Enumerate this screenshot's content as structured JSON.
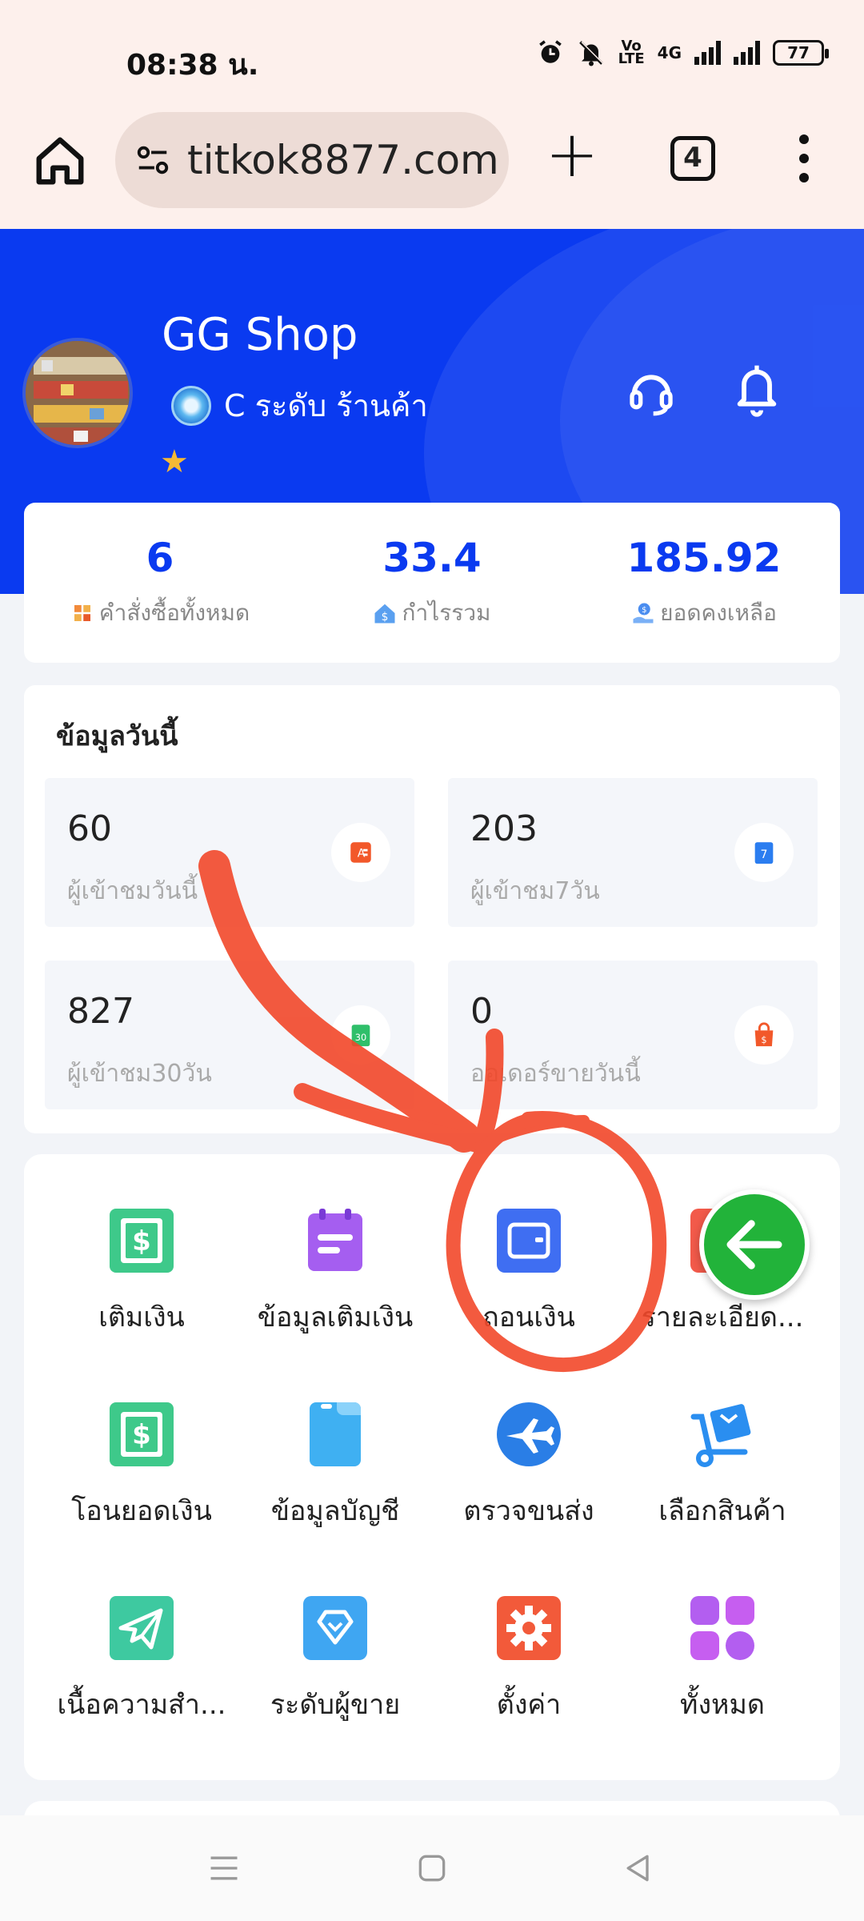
{
  "status": {
    "time": "08:38 น.",
    "battery": "77",
    "network": "4G"
  },
  "browser": {
    "url": "titkok8877.com",
    "tab_count": "4"
  },
  "header": {
    "shop_name": "GG Shop",
    "level_text": "C ระดับ ร้านค้า"
  },
  "stats": [
    {
      "value": "6",
      "label": "คำสั่งซื้อทั้งหมด"
    },
    {
      "value": "33.4",
      "label": "กำไรรวม"
    },
    {
      "value": "185.92",
      "label": "ยอดคงเหลือ"
    }
  ],
  "today": {
    "title": "ข้อมูลวันนี้",
    "tiles": [
      {
        "value": "60",
        "label": "ผู้เข้าชมวันนี้"
      },
      {
        "value": "203",
        "label": "ผู้เข้าชม7วัน"
      },
      {
        "value": "827",
        "label": "ผู้เข้าชม30วัน"
      },
      {
        "value": "0",
        "label": "ออเดอร์ขายวันนี้"
      }
    ]
  },
  "menu": [
    {
      "label": "เติมเงิน",
      "icon": "dollar-card-icon"
    },
    {
      "label": "ข้อมูลเติมเงิน",
      "icon": "calendar-list-icon"
    },
    {
      "label": "ถอนเงิน",
      "icon": "wallet-icon"
    },
    {
      "label": "รายละเอียด...",
      "icon": "details-icon"
    },
    {
      "label": "โอนยอดเงิน",
      "icon": "dollar-card-icon"
    },
    {
      "label": "ข้อมูลบัญชี",
      "icon": "account-card-icon"
    },
    {
      "label": "ตรวจขนส่ง",
      "icon": "airplane-icon"
    },
    {
      "label": "เลือกสินค้า",
      "icon": "cart-box-icon"
    },
    {
      "label": "เนื้อความสำ...",
      "icon": "paper-plane-icon"
    },
    {
      "label": "ระดับผู้ขาย",
      "icon": "diamond-icon"
    },
    {
      "label": "ตั้งค่า",
      "icon": "gear-icon"
    },
    {
      "label": "ทั้งหมด",
      "icon": "grid-icon"
    }
  ],
  "colors": {
    "brand_blue": "#0a3af0",
    "annotation_red": "#f2482a",
    "fab_green": "#22b33a"
  }
}
